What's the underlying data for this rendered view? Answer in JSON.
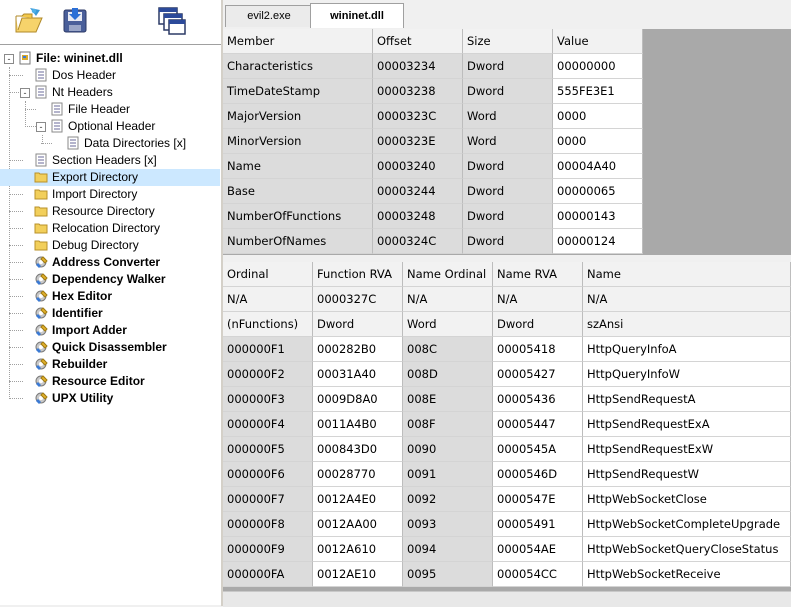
{
  "toolbar": {
    "open_icon": "open-file-icon",
    "save_icon": "save-file-icon",
    "windows_icon": "windows-icon"
  },
  "tree": {
    "nodes": [
      {
        "label": "File: wininet.dll",
        "icon": "file-icon",
        "bold": true,
        "selected": false,
        "expander": "-"
      },
      {
        "label": "Dos Header",
        "icon": "page-icon",
        "bold": false,
        "selected": false,
        "expander": ""
      },
      {
        "label": "Nt Headers",
        "icon": "page-icon",
        "bold": false,
        "selected": false,
        "expander": "-"
      },
      {
        "label": "File Header",
        "icon": "page-icon",
        "bold": false,
        "selected": false,
        "expander": ""
      },
      {
        "label": "Optional Header",
        "icon": "page-icon",
        "bold": false,
        "selected": false,
        "expander": "-"
      },
      {
        "label": "Data Directories [x]",
        "icon": "page-icon",
        "bold": false,
        "selected": false,
        "expander": ""
      },
      {
        "label": "Section Headers [x]",
        "icon": "page-icon",
        "bold": false,
        "selected": false,
        "expander": ""
      },
      {
        "label": "Export Directory",
        "icon": "folder-icon",
        "bold": false,
        "selected": true,
        "expander": ""
      },
      {
        "label": "Import Directory",
        "icon": "folder-icon",
        "bold": false,
        "selected": false,
        "expander": ""
      },
      {
        "label": "Resource Directory",
        "icon": "folder-icon",
        "bold": false,
        "selected": false,
        "expander": ""
      },
      {
        "label": "Relocation Directory",
        "icon": "folder-icon",
        "bold": false,
        "selected": false,
        "expander": ""
      },
      {
        "label": "Debug Directory",
        "icon": "folder-icon",
        "bold": false,
        "selected": false,
        "expander": ""
      },
      {
        "label": "Address Converter",
        "icon": "tool-icon",
        "bold": true,
        "selected": false,
        "expander": ""
      },
      {
        "label": "Dependency Walker",
        "icon": "tool-icon",
        "bold": true,
        "selected": false,
        "expander": ""
      },
      {
        "label": "Hex Editor",
        "icon": "tool-icon",
        "bold": true,
        "selected": false,
        "expander": ""
      },
      {
        "label": "Identifier",
        "icon": "tool-icon",
        "bold": true,
        "selected": false,
        "expander": ""
      },
      {
        "label": "Import Adder",
        "icon": "tool-icon",
        "bold": true,
        "selected": false,
        "expander": ""
      },
      {
        "label": "Quick Disassembler",
        "icon": "tool-icon",
        "bold": true,
        "selected": false,
        "expander": ""
      },
      {
        "label": "Rebuilder",
        "icon": "tool-icon",
        "bold": true,
        "selected": false,
        "expander": ""
      },
      {
        "label": "Resource Editor",
        "icon": "tool-icon",
        "bold": true,
        "selected": false,
        "expander": ""
      },
      {
        "label": "UPX Utility",
        "icon": "tool-icon",
        "bold": true,
        "selected": false,
        "expander": ""
      }
    ]
  },
  "tabs": [
    {
      "label": "evil2.exe",
      "active": false
    },
    {
      "label": "wininet.dll",
      "active": true
    }
  ],
  "export_directory": {
    "columns": [
      "Member",
      "Offset",
      "Size",
      "Value"
    ],
    "rows": [
      [
        "Characteristics",
        "00003234",
        "Dword",
        "00000000"
      ],
      [
        "TimeDateStamp",
        "00003238",
        "Dword",
        "555FE3E1"
      ],
      [
        "MajorVersion",
        "0000323C",
        "Word",
        "0000"
      ],
      [
        "MinorVersion",
        "0000323E",
        "Word",
        "0000"
      ],
      [
        "Name",
        "00003240",
        "Dword",
        "00004A40"
      ],
      [
        "Base",
        "00003244",
        "Dword",
        "00000065"
      ],
      [
        "NumberOfFunctions",
        "00003248",
        "Dword",
        "00000143"
      ],
      [
        "NumberOfNames",
        "0000324C",
        "Dword",
        "00000124"
      ]
    ]
  },
  "exports": {
    "columns": [
      "Ordinal",
      "Function RVA",
      "Name Ordinal",
      "Name RVA",
      "Name"
    ],
    "info_rows": [
      [
        "N/A",
        "0000327C",
        "N/A",
        "N/A",
        "N/A"
      ],
      [
        "(nFunctions)",
        "Dword",
        "Word",
        "Dword",
        "szAnsi"
      ]
    ],
    "rows": [
      [
        "000000F1",
        "000282B0",
        "008C",
        "00005418",
        "HttpQueryInfoA"
      ],
      [
        "000000F2",
        "00031A40",
        "008D",
        "00005427",
        "HttpQueryInfoW"
      ],
      [
        "000000F3",
        "0009D8A0",
        "008E",
        "00005436",
        "HttpSendRequestA"
      ],
      [
        "000000F4",
        "0011A4B0",
        "008F",
        "00005447",
        "HttpSendRequestExA"
      ],
      [
        "000000F5",
        "000843D0",
        "0090",
        "0000545A",
        "HttpSendRequestExW"
      ],
      [
        "000000F6",
        "00028770",
        "0091",
        "0000546D",
        "HttpSendRequestW"
      ],
      [
        "000000F7",
        "0012A4E0",
        "0092",
        "0000547E",
        "HttpWebSocketClose"
      ],
      [
        "000000F8",
        "0012AA00",
        "0093",
        "00005491",
        "HttpWebSocketCompleteUpgrade"
      ],
      [
        "000000F9",
        "0012A610",
        "0094",
        "000054AE",
        "HttpWebSocketQueryCloseStatus"
      ],
      [
        "000000FA",
        "0012AE10",
        "0095",
        "000054CC",
        "HttpWebSocketReceive"
      ]
    ]
  }
}
